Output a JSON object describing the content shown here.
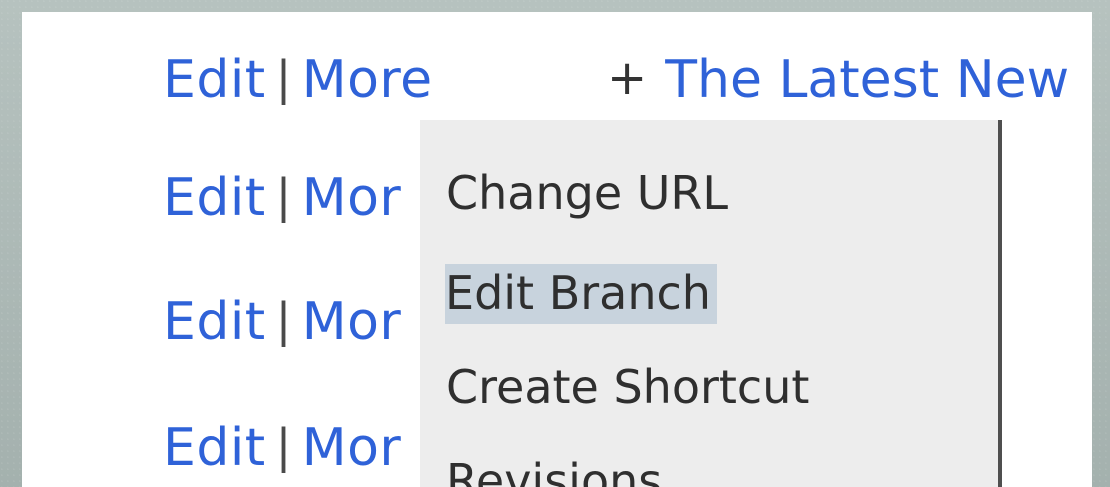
{
  "rows": [
    {
      "edit_label": "Edit",
      "separator": "|",
      "more_label": "More"
    },
    {
      "edit_label": "Edit",
      "separator": "|",
      "more_label": "Mor"
    },
    {
      "edit_label": "Edit",
      "separator": "|",
      "more_label": "Mor"
    },
    {
      "edit_label": "Edit",
      "separator": "|",
      "more_label": "Mor"
    }
  ],
  "header": {
    "plus_label": "+",
    "latest_link": "The Latest New"
  },
  "menu": {
    "items": [
      {
        "label": "Change URL",
        "highlighted": false
      },
      {
        "label": "Edit Branch",
        "highlighted": true
      },
      {
        "label": "Create Shortcut",
        "highlighted": false
      },
      {
        "label": "Revisions",
        "highlighted": false
      }
    ]
  },
  "colors": {
    "link": "#2f62d8",
    "menu_background": "#ededed",
    "menu_highlight": "#c8d3dd",
    "text": "#2f2f2f"
  }
}
